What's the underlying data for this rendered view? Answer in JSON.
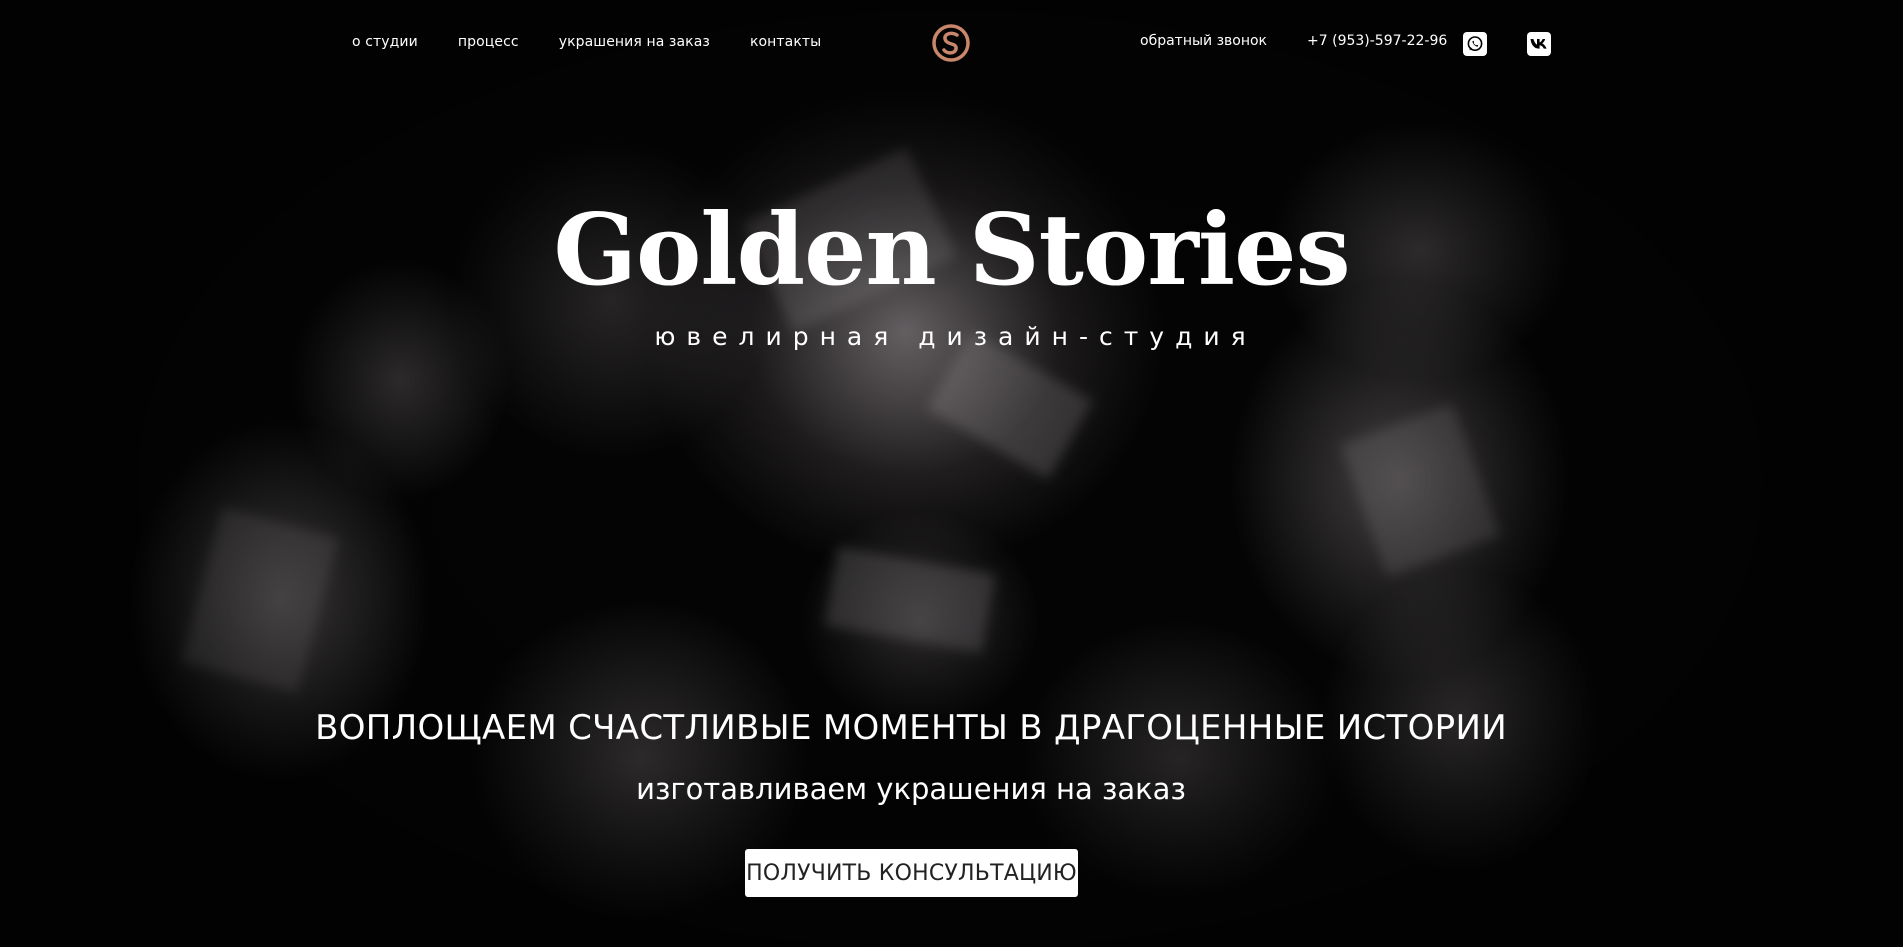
{
  "header": {
    "nav": [
      {
        "label": "о студии"
      },
      {
        "label": "процесс"
      },
      {
        "label": "украшения на заказ"
      },
      {
        "label": "контакты"
      }
    ],
    "logo_icon": "golden-s-logo-icon",
    "callback_label": "обратный звонок",
    "phone": "+7 (953)-597-22-96",
    "social": [
      {
        "icon": "whatsapp-icon"
      },
      {
        "icon": "vk-icon"
      }
    ]
  },
  "hero": {
    "brand_title": "Golden Stories",
    "brand_subtitle": "ювелирная дизайн-студия",
    "headline": "ВОПЛОЩАЕМ СЧАСТЛИВЫЕ МОМЕНТЫ В ДРАГОЦЕННЫЕ ИСТОРИИ",
    "subheadline": "изготавливаем украшения на заказ",
    "cta_label": "ПОЛУЧИТЬ КОНСУЛЬТАЦИЮ"
  },
  "colors": {
    "background": "#050505",
    "text": "#ffffff",
    "logo_accent": "#c8866a",
    "button_bg": "#ffffff",
    "button_text": "#222222"
  }
}
